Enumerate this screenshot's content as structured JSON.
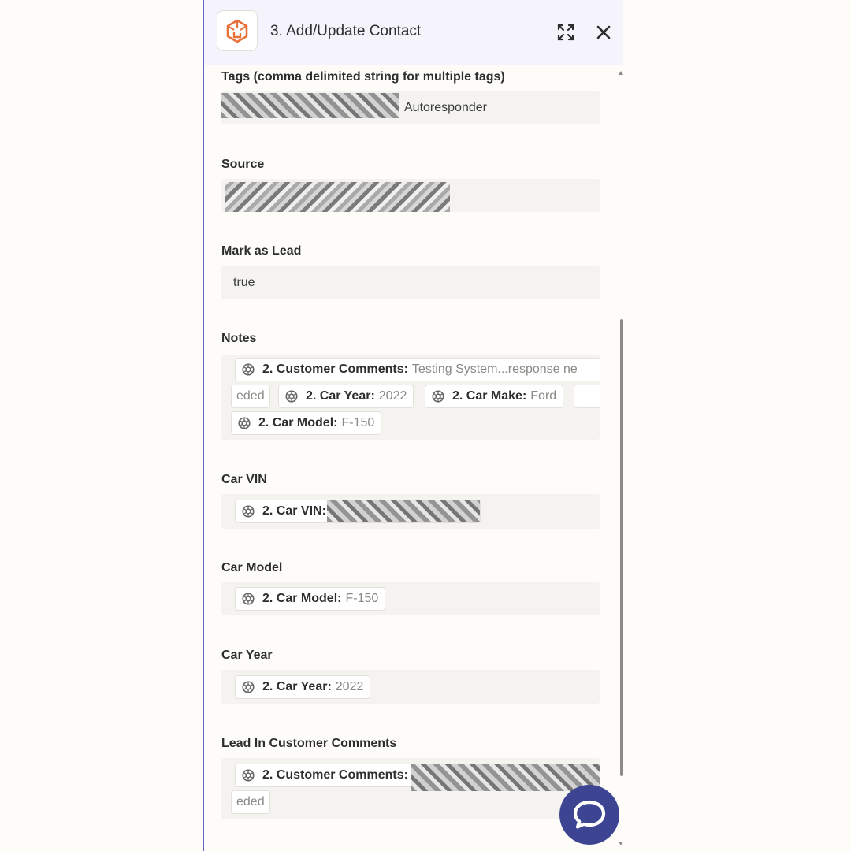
{
  "header": {
    "title": "3. Add/Update Contact",
    "app_icon": "keap-cube-icon",
    "expand_icon": "expand-icon",
    "close_icon": "close-icon",
    "accent_color": "#6563c7",
    "brand_color": "#e8703a"
  },
  "fields": {
    "tags": {
      "label": "Tags (comma delimited string for multiple tags)",
      "value_visible": "Autoresponder"
    },
    "source": {
      "label": "Source"
    },
    "mark_as_lead": {
      "label": "Mark as Lead",
      "value": "true"
    },
    "notes": {
      "label": "Notes",
      "pills": [
        {
          "key": "2. Customer Comments:",
          "value": "Testing System...response ne"
        },
        {
          "key": "",
          "value": "eded"
        },
        {
          "key": "2. Car Year:",
          "value": "2022"
        },
        {
          "key": "2. Car Make:",
          "value": "Ford"
        },
        {
          "key": "2. Car Model:",
          "value": "F-150"
        }
      ]
    },
    "car_vin": {
      "label": "Car VIN",
      "pill_key": "2. Car VIN:"
    },
    "car_model": {
      "label": "Car Model",
      "pill_key": "2. Car Model:",
      "pill_value": "F-150"
    },
    "car_year": {
      "label": "Car Year",
      "pill_key": "2. Car Year:",
      "pill_value": "2022"
    },
    "lead_comments": {
      "label": "Lead In Customer Comments",
      "pill_key": "2. Customer Comments:",
      "continuation": "eded"
    }
  },
  "chat": {
    "icon": "chat-bubble-icon",
    "color": "#3d4592"
  }
}
